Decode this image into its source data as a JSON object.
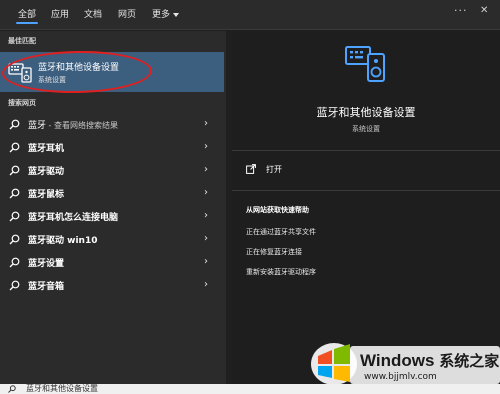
{
  "tabs": [
    {
      "label": "全部",
      "active": true
    },
    {
      "label": "应用"
    },
    {
      "label": "文档"
    },
    {
      "label": "网页"
    },
    {
      "label": "更多"
    }
  ],
  "topbar": {
    "more_icon": "ellipsis-icon",
    "close_icon": "close-icon"
  },
  "left": {
    "best_match_label": "最佳匹配",
    "best_match": {
      "title": "蓝牙和其他设备设置",
      "subtitle": "系统设置"
    },
    "web_search_label": "搜索网页",
    "results": [
      {
        "term": "蓝牙",
        "hint": " - 查看网络搜索结果"
      },
      {
        "term": "蓝牙耳机"
      },
      {
        "term": "蓝牙驱动"
      },
      {
        "term": "蓝牙鼠标"
      },
      {
        "term": "蓝牙耳机怎么连接电脑"
      },
      {
        "term": "蓝牙驱动 win10"
      },
      {
        "term": "蓝牙设置"
      },
      {
        "term": "蓝牙音箱"
      }
    ]
  },
  "right": {
    "title": "蓝牙和其他设备设置",
    "subtitle": "系统设置",
    "open_label": "打开",
    "web_help_label": "从网站获取快速帮助",
    "links": [
      "正在通过蓝牙共享文件",
      "正在修复蓝牙连接",
      "重新安装蓝牙驱动程序"
    ]
  },
  "bottom": {
    "search_text": "蓝牙和其他设备设置"
  },
  "watermark": {
    "brand": "Windows",
    "brand_cn": "系统之家",
    "url": "www.bjjmlv.com"
  },
  "colors": {
    "accent": "#4da3ff",
    "selected_bg": "#3d5f7f",
    "highlight_ring": "#e02020"
  }
}
